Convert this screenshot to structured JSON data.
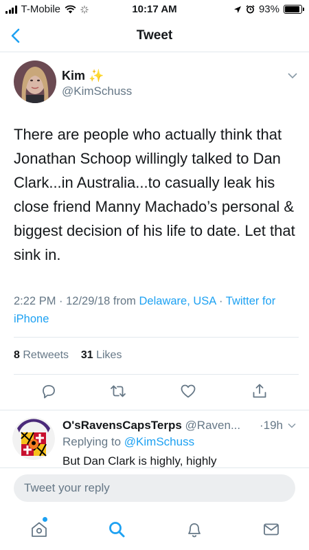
{
  "status_bar": {
    "carrier": "T-Mobile",
    "time": "10:17 AM",
    "battery": "93%",
    "battery_level": 0.93
  },
  "nav": {
    "title": "Tweet",
    "back_icon": "chevron-left-icon"
  },
  "tweet": {
    "author_name": "Kim",
    "author_emoji": "✨",
    "author_handle": "@KimSchuss",
    "text": "There are people who actually think that Jonathan Schoop willingly talked to Dan Clark...in Australia...to casually leak his close friend Manny Machado’s personal & biggest decision of his life to date. Let that sink in.",
    "timestamp": "2:22 PM · 12/29/18 from ",
    "location": "Delaware, USA",
    "separator": " · ",
    "source": "Twitter for iPhone",
    "retweets_count": "8",
    "retweets_label": "Retweets",
    "likes_count": "31",
    "likes_label": "Likes"
  },
  "reply": {
    "name": "O'sRavensCapsTerps",
    "handle": "@Raven...",
    "time": "·19h",
    "replying_prefix": "Replying to ",
    "replying_to": "@KimSchuss",
    "text": "But Dan Clark is highly, highly"
  },
  "compose": {
    "placeholder": "Tweet your reply"
  },
  "colors": {
    "accent": "#1da1f2",
    "muted": "#657786",
    "border": "#e1e8ed"
  }
}
